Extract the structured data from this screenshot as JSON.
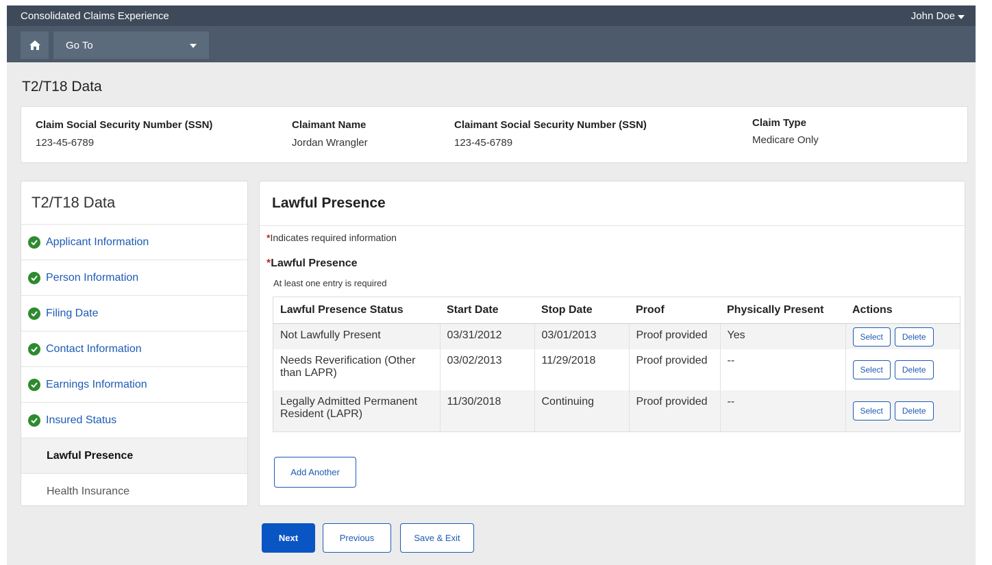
{
  "header": {
    "app_title": "Consolidated Claims Experience",
    "user_name": "John Doe",
    "goto_label": "Go To"
  },
  "page": {
    "title": "T2/T18 Data"
  },
  "summary": {
    "claim_ssn_label": "Claim Social Security Number (SSN)",
    "claim_ssn_value": "123-45-6789",
    "claimant_name_label": "Claimant Name",
    "claimant_name_value": "Jordan Wrangler",
    "claimant_ssn_label": "Claimant Social Security Number (SSN)",
    "claimant_ssn_value": "123-45-6789",
    "claim_type_label": "Claim Type",
    "claim_type_value": "Medicare Only"
  },
  "sidebar": {
    "title": "T2/T18 Data",
    "items": [
      {
        "label": "Applicant Information",
        "status": "complete"
      },
      {
        "label": "Person Information",
        "status": "complete"
      },
      {
        "label": "Filing Date",
        "status": "complete"
      },
      {
        "label": "Contact Information",
        "status": "complete"
      },
      {
        "label": "Earnings Information",
        "status": "complete"
      },
      {
        "label": "Insured Status",
        "status": "complete"
      },
      {
        "label": "Lawful Presence",
        "status": "active"
      },
      {
        "label": "Health Insurance",
        "status": "pending"
      }
    ]
  },
  "main": {
    "title": "Lawful Presence",
    "required_note": "Indicates required information",
    "required_mark": "*",
    "field_label": "Lawful Presence",
    "field_hint": "At least one entry is required",
    "table": {
      "headers": [
        "Lawful Presence Status",
        "Start Date",
        "Stop Date",
        "Proof",
        "Physically Present",
        "Actions"
      ],
      "rows": [
        {
          "status": "Not Lawfully Present",
          "start": "03/31/2012",
          "stop": "03/01/2013",
          "proof": "Proof provided",
          "present": "Yes"
        },
        {
          "status": "Needs Reverification (Other than LAPR)",
          "start": "03/02/2013",
          "stop": "11/29/2018",
          "proof": "Proof provided",
          "present": "--"
        },
        {
          "status": "Legally Admitted Permanent Resident (LAPR)",
          "start": "11/30/2018",
          "stop": "Continuing",
          "proof": "Proof provided",
          "present": "--"
        }
      ],
      "select_label": "Select",
      "delete_label": "Delete"
    },
    "add_another_label": "Add Another"
  },
  "footer": {
    "next_label": "Next",
    "previous_label": "Previous",
    "save_exit_label": "Save & Exit"
  },
  "colors": {
    "header_bg": "#4c5a6b",
    "header_strip": "#3e4a59",
    "link_blue": "#1c5bb5",
    "primary_button": "#0a55c4",
    "complete_green": "#2e8a2e",
    "required_red": "#c62828"
  },
  "icons": {
    "home": "home-icon",
    "goto_caret": "caret-down-icon",
    "complete": "check-circle-icon"
  }
}
